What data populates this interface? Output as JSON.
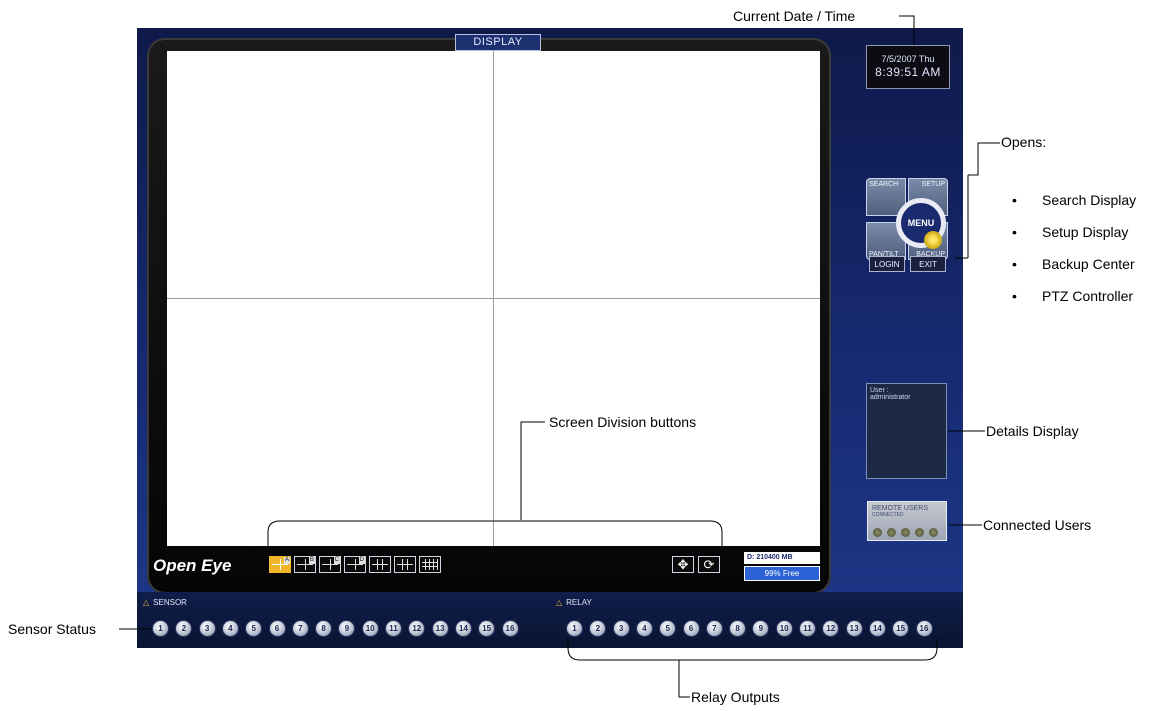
{
  "window": {
    "tab_title": "DISPLAY",
    "brand": "Open Eye"
  },
  "datetime": {
    "date": "7/5/2007 Thu",
    "time": "8:39:51 AM"
  },
  "menu": {
    "center_label": "MENU",
    "search_label": "SEARCH",
    "setup_label": "SETUP",
    "pantilt_label": "PAN/TILT",
    "backup_label": "BACKUP",
    "login_label": "LOGIN",
    "exit_label": "EXIT"
  },
  "details": {
    "user_label": "User :",
    "user_value": "administrator"
  },
  "remote_users": {
    "title": "REMOTE USERS",
    "subtitle": "CONNECTED"
  },
  "division_buttons": [
    "A",
    "B",
    "C",
    "D",
    "",
    "",
    ""
  ],
  "disk": {
    "label": "D: 210400 MB",
    "free": "99% Free"
  },
  "sensor": {
    "label": "SENSOR",
    "numbers": [
      "1",
      "2",
      "3",
      "4",
      "5",
      "6",
      "7",
      "8",
      "9",
      "10",
      "11",
      "12",
      "13",
      "14",
      "15",
      "16"
    ]
  },
  "relay": {
    "label": "RELAY",
    "numbers": [
      "1",
      "2",
      "3",
      "4",
      "5",
      "6",
      "7",
      "8",
      "9",
      "10",
      "11",
      "12",
      "13",
      "14",
      "15",
      "16"
    ]
  },
  "annotations": {
    "current_datetime": "Current Date / Time",
    "opens": "Opens:",
    "opens_items": [
      "Search Display",
      "Setup Display",
      "Backup Center",
      "PTZ Controller"
    ],
    "screen_division": "Screen Division buttons",
    "details_display": "Details Display",
    "connected_users": "Connected Users",
    "sensor_status": "Sensor Status",
    "relay_outputs": "Relay Outputs"
  }
}
